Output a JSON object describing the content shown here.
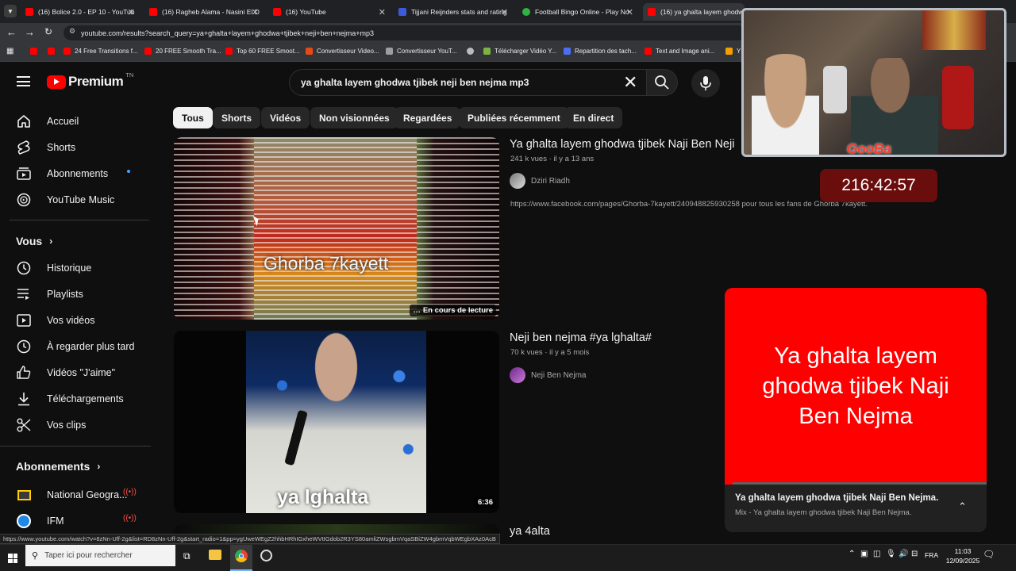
{
  "browser": {
    "tabs": [
      {
        "title": "(16) Bolice 2.0 - EP 10 - YouTub",
        "color": "#ff0000"
      },
      {
        "title": "(16) Ragheb Alama - Nasini El D",
        "color": "#ff0000"
      },
      {
        "title": "(16) YouTube",
        "color": "#ff0000"
      },
      {
        "title": "Tijjani Reijnders stats and rating",
        "color": "#3b5bdb"
      },
      {
        "title": "Football Bingo Online - Play No",
        "color": "#2fb344"
      },
      {
        "title": "(16) ya ghalta layem ghodwa",
        "color": "#ff0000"
      }
    ],
    "url": "youtube.com/results?search_query=ya+ghalta+layem+ghodwa+tjibek+neji+ben+nejma+mp3",
    "bookmarks": [
      {
        "label": "",
        "color": "#ff0000"
      },
      {
        "label": "",
        "color": "#ff0000"
      },
      {
        "label": "24 Free Transitions f...",
        "color": "#ff0000"
      },
      {
        "label": "20 FREE Smooth Tra...",
        "color": "#ff0000"
      },
      {
        "label": "Top 60 FREE Smoot...",
        "color": "#ff0000"
      },
      {
        "label": "Convertisseur Video...",
        "color": "#e64a19"
      },
      {
        "label": "Convertisseur YouT...",
        "color": "#9e9e9e"
      },
      {
        "label": "",
        "color": "#bbbbbb"
      },
      {
        "label": "Télécharger Vidéo Y...",
        "color": "#7cb342"
      },
      {
        "label": "Repartition des tach...",
        "color": "#4c6ef5"
      },
      {
        "label": "Text and Image ani...",
        "color": "#ff0000"
      },
      {
        "label": "Y",
        "color": "#f59f00"
      }
    ],
    "status_url": "https://www.youtube.com/watch?v=8zNn-Uff-2g&list=RD8zNn-Uff-2g&start_radio=1&pp=ygUweWEgZ2hhbHRhIGxheWVtIGdob2R3YS80amliZWsgbmVqaSBiZW4gbmVqbWEgbXAz0AcB"
  },
  "youtube": {
    "logo_text": "Premium",
    "logo_superscript": "TN",
    "search_value": "ya ghalta layem ghodwa tjibek neji ben nejma mp3",
    "chips": [
      "Tous",
      "Shorts",
      "Vidéos",
      "Non visionnées",
      "Regardées",
      "Publiées récemment",
      "En direct"
    ],
    "sidebar": {
      "main": [
        {
          "label": "Accueil",
          "icon": "home-icon"
        },
        {
          "label": "Shorts",
          "icon": "shorts-icon"
        },
        {
          "label": "Abonnements",
          "icon": "subscriptions-icon"
        },
        {
          "label": "YouTube Music",
          "icon": "youtube-music-icon"
        }
      ],
      "you_header": "Vous",
      "you": [
        {
          "label": "Historique",
          "icon": "history-icon"
        },
        {
          "label": "Playlists",
          "icon": "playlists-icon"
        },
        {
          "label": "Vos vidéos",
          "icon": "your-videos-icon"
        },
        {
          "label": "À regarder plus tard",
          "icon": "watch-later-icon"
        },
        {
          "label": "Vidéos \"J'aime\"",
          "icon": "like-icon"
        },
        {
          "label": "Téléchargements",
          "icon": "download-icon"
        },
        {
          "label": "Vos clips",
          "icon": "clips-icon"
        }
      ],
      "subs_header": "Abonnements",
      "subs": [
        {
          "label": "National Geogra...",
          "color": "#ffcc00"
        },
        {
          "label": "IFM",
          "color": "#1e88e5"
        }
      ]
    },
    "results": [
      {
        "title": "Ya ghalta layem ghodwa tjibek Naji Ben Neji",
        "views": "241 k vues",
        "age": "il y a 13 ans",
        "channel": "Dziri Riadh",
        "description": "https://www.facebook.com/pages/Ghorba-7kayett/240948825930258 pour tous les fans de Ghorba 7kayett.",
        "thumb_text": "Ghorba 7kayett",
        "badge": "En cours de lecture"
      },
      {
        "title": "Neji ben nejma #ya lghalta#",
        "views": "70 k vues",
        "age": "il y a 5 mois",
        "channel": "Neji Ben Nejma",
        "thumb_text": "ya lghalta",
        "badge": "6:36"
      },
      {
        "title": "ya 4alta"
      }
    ],
    "miniplayer": {
      "card_text": "Ya ghalta layem ghodwa tjibek Naji Ben Nejma",
      "title": "Ya ghalta layem ghodwa tjibek Naji Ben Nejma.",
      "subtitle": "Mix - Ya ghalta layem ghodwa tjibek Naji Ben Nejma.",
      "progress": 0.03
    }
  },
  "overlay": {
    "webcam_logo": "GooBa",
    "timer": "216:42:57"
  },
  "taskbar": {
    "search_placeholder": "Taper ici pour rechercher",
    "language": "FRA",
    "time": "11:03",
    "date": "12/09/2025"
  }
}
